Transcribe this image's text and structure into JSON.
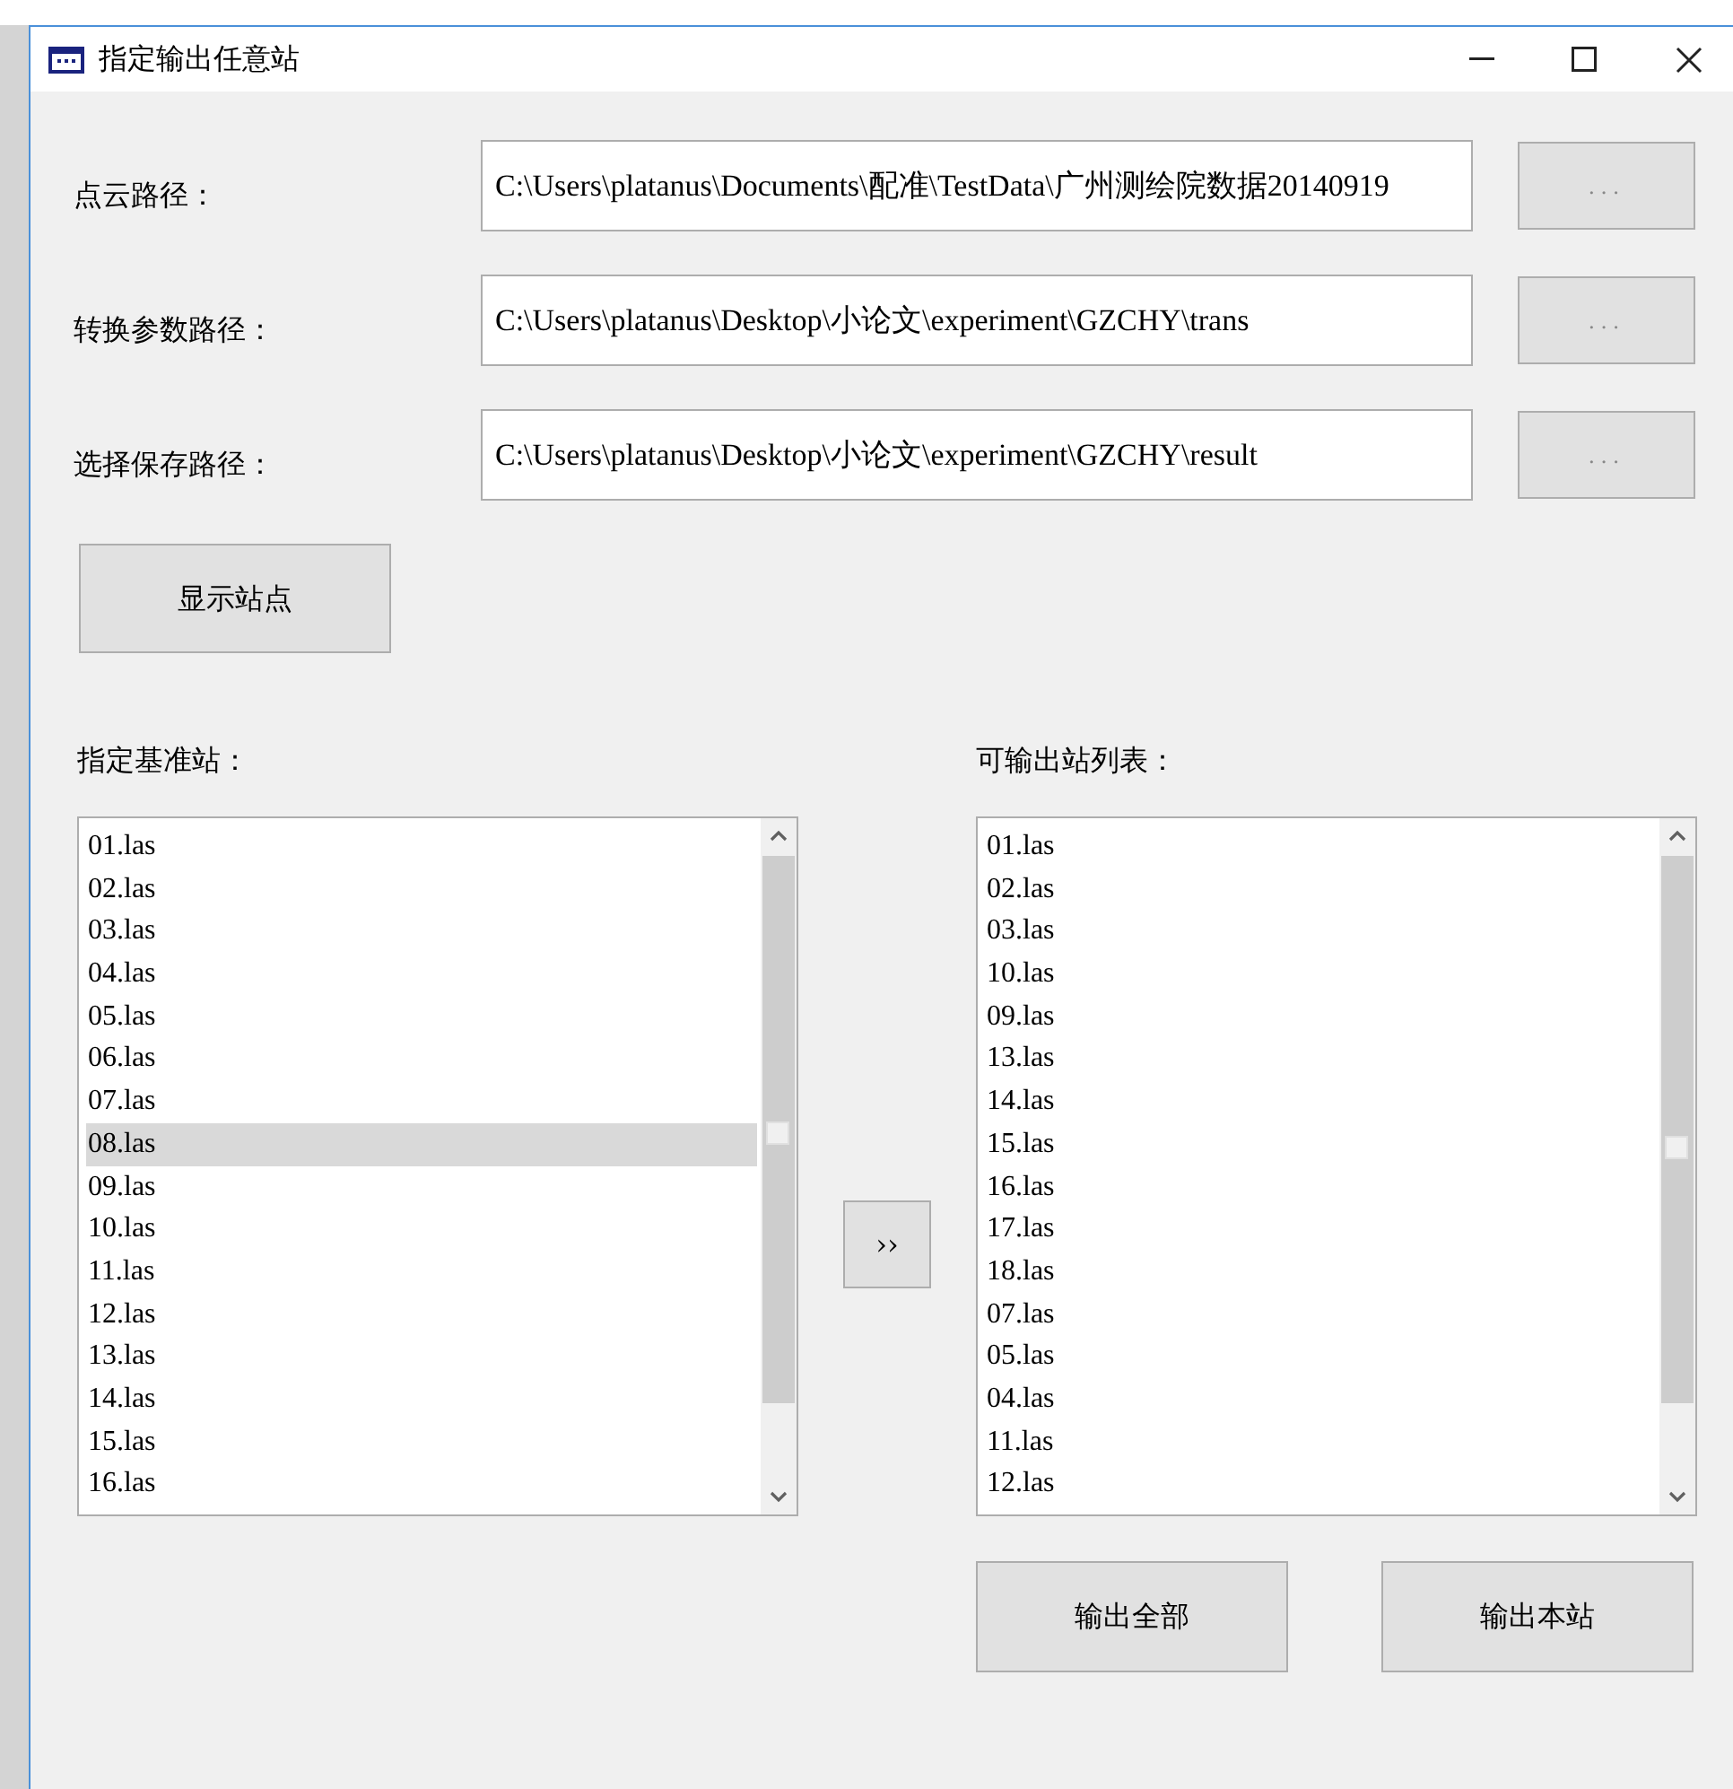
{
  "window": {
    "title": "指定输出任意站"
  },
  "paths": [
    {
      "label": "点云路径：",
      "value": "C:\\Users\\platanus\\Documents\\配准\\TestData\\广州测绘院数据20140919",
      "browse": "..."
    },
    {
      "label": "转换参数路径：",
      "value": "C:\\Users\\platanus\\Desktop\\小论文\\experiment\\GZCHY\\trans",
      "browse": "..."
    },
    {
      "label": "选择保存路径：",
      "value": "C:\\Users\\platanus\\Desktop\\小论文\\experiment\\GZCHY\\result",
      "browse": "..."
    }
  ],
  "show_button": "显示站点",
  "base_list": {
    "label": "指定基准站：",
    "items": [
      {
        "text": "01.las",
        "selected": false
      },
      {
        "text": "02.las",
        "selected": false
      },
      {
        "text": "03.las",
        "selected": false
      },
      {
        "text": "04.las",
        "selected": false
      },
      {
        "text": "05.las",
        "selected": false
      },
      {
        "text": "06.las",
        "selected": false
      },
      {
        "text": "07.las",
        "selected": false
      },
      {
        "text": "08.las",
        "selected": true
      },
      {
        "text": "09.las",
        "selected": false
      },
      {
        "text": "10.las",
        "selected": false
      },
      {
        "text": "11.las",
        "selected": false
      },
      {
        "text": "12.las",
        "selected": false
      },
      {
        "text": "13.las",
        "selected": false
      },
      {
        "text": "14.las",
        "selected": false
      },
      {
        "text": "15.las",
        "selected": false
      },
      {
        "text": "16.las",
        "selected": false
      }
    ]
  },
  "move_button": "››",
  "output_list": {
    "label": "可输出站列表：",
    "items": [
      {
        "text": "01.las",
        "selected": false
      },
      {
        "text": "02.las",
        "selected": false
      },
      {
        "text": "03.las",
        "selected": false
      },
      {
        "text": "10.las",
        "selected": false
      },
      {
        "text": "09.las",
        "selected": false
      },
      {
        "text": "13.las",
        "selected": false
      },
      {
        "text": "14.las",
        "selected": false
      },
      {
        "text": "15.las",
        "selected": false
      },
      {
        "text": "16.las",
        "selected": false
      },
      {
        "text": "17.las",
        "selected": false
      },
      {
        "text": "18.las",
        "selected": false
      },
      {
        "text": "07.las",
        "selected": false
      },
      {
        "text": "05.las",
        "selected": false
      },
      {
        "text": "04.las",
        "selected": false
      },
      {
        "text": "11.las",
        "selected": false
      },
      {
        "text": "12.las",
        "selected": false
      }
    ]
  },
  "bottom_buttons": [
    "输出全部",
    "输出本站"
  ]
}
